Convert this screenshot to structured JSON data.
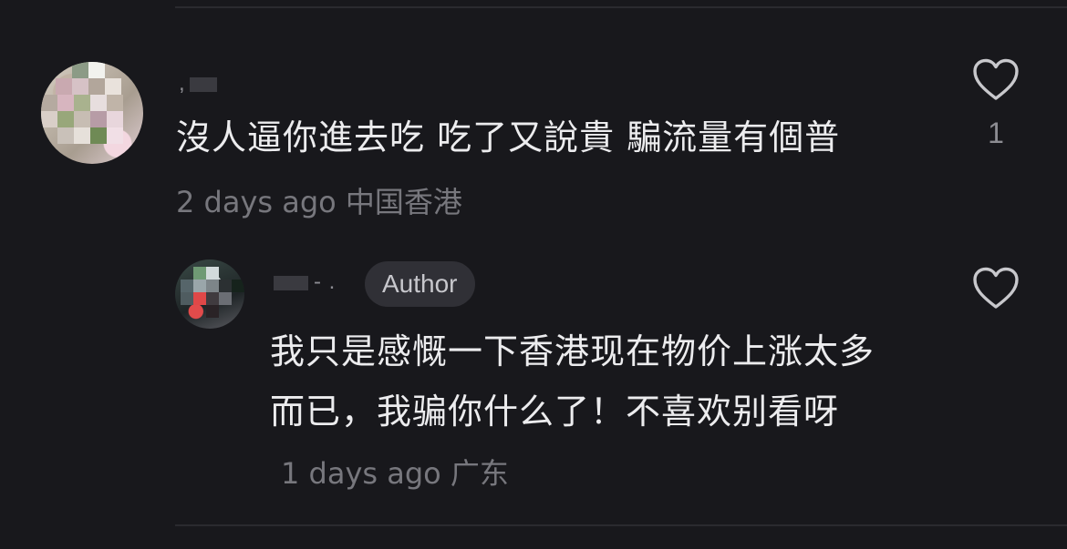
{
  "comments": [
    {
      "username": ",",
      "text": "沒人逼你進去吃 吃了又說貴 騙流量有個普",
      "time": "2 days ago",
      "location": "中国香港",
      "likes": "1"
    }
  ],
  "reply": {
    "username": "- .",
    "badge": "Author",
    "text": "我只是感慨一下香港现在物价上涨太多而已，我骗你什么了！不喜欢别看呀",
    "time": "1 days ago",
    "location": "广东"
  },
  "colors": {
    "background": "#18181c",
    "text": "#ececee",
    "meta": "#77777d",
    "badge_bg": "#303036"
  }
}
